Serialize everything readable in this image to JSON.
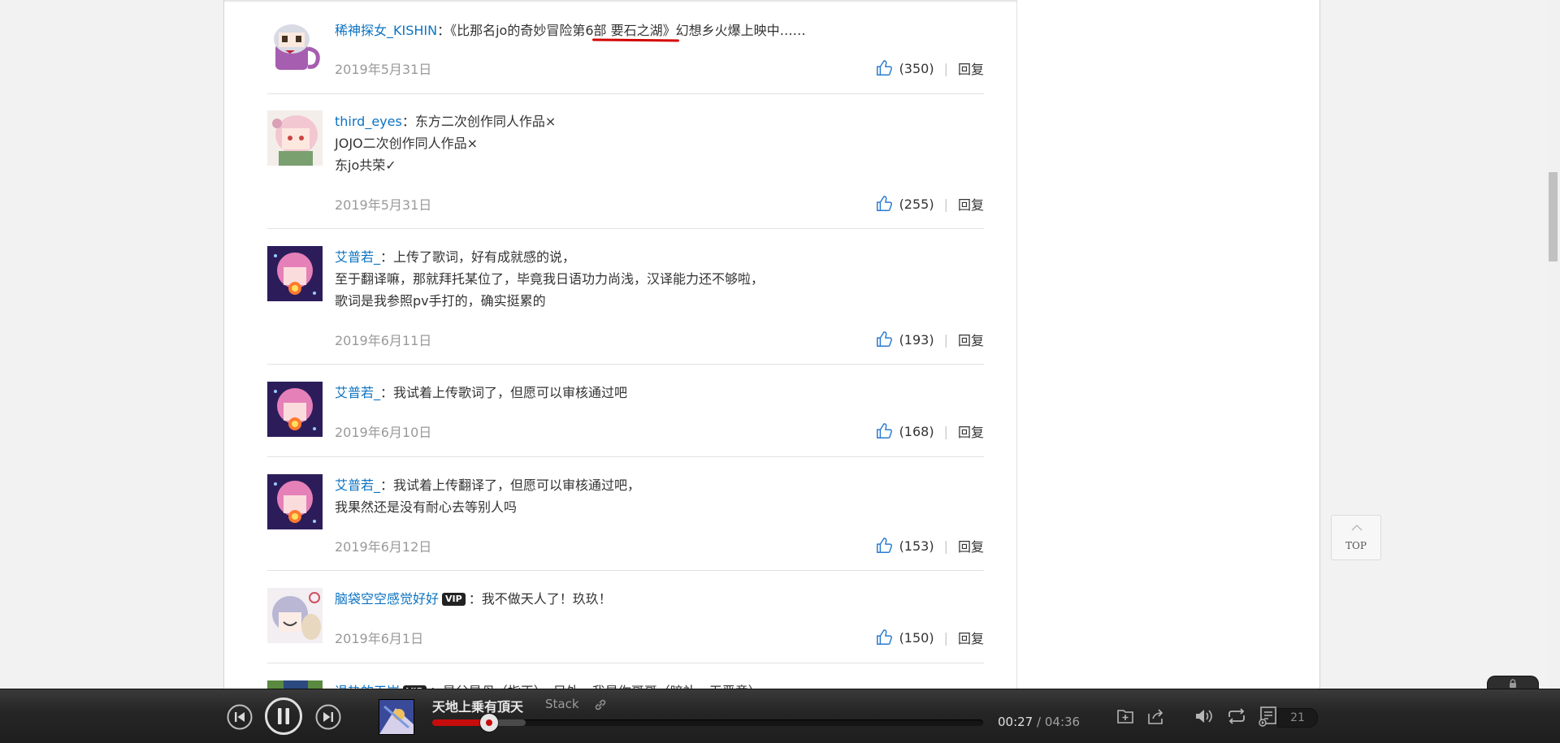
{
  "comments": [
    {
      "user": "稀神探女_KISHIN",
      "vip": "",
      "lines": [
        [
          "：《比那名jo的奇妙冒险第6",
          "部 要石之湖》",
          "幻想乡火爆上映中……"
        ]
      ],
      "date": "2019年5月31日",
      "likes": "(350)",
      "reply": "回复"
    },
    {
      "user": "third_eyes",
      "vip": "",
      "lines": [
        "：东方二次创作同人作品×",
        "JOJO二次创作同人作品×",
        "东jo共荣✓"
      ],
      "date": "2019年5月31日",
      "likes": "(255)",
      "reply": "回复"
    },
    {
      "user": "艾普若_",
      "vip": "",
      "lines": [
        "：上传了歌词，好有成就感的说，",
        "至于翻译嘛，那就拜托某位了，毕竟我日语功力尚浅，汉译能力还不够啦，",
        "歌词是我参照pv手打的，确实挺累的"
      ],
      "date": "2019年6月11日",
      "likes": "(193)",
      "reply": "回复"
    },
    {
      "user": "艾普若_",
      "vip": "",
      "lines": [
        "：我试着上传歌词了，但愿可以审核通过吧"
      ],
      "date": "2019年6月10日",
      "likes": "(168)",
      "reply": "回复"
    },
    {
      "user": "艾普若_",
      "vip": "",
      "lines": [
        "：我试着上传翻译了，但愿可以审核通过吧，",
        "我果然还是没有耐心去等别人吗"
      ],
      "date": "2019年6月12日",
      "likes": "(153)",
      "reply": "回复"
    },
    {
      "user": "脑袋空空感觉好好",
      "vip": "VIP",
      "lines": [
        "：我不做天人了！玖玖！"
      ],
      "date": "2019年6月1日",
      "likes": "(150)",
      "reply": "回复"
    },
    {
      "user": "退热的天崩",
      "vip": "VIP",
      "lines": [
        "：是父是母（指正），另外，我是你哥哥（暗补，无恶意）"
      ],
      "date": "",
      "likes": "",
      "reply": ""
    }
  ],
  "top_button": {
    "label": "TOP"
  },
  "player": {
    "song_title": "天地上乗有頂天",
    "artist": "Stack",
    "current_time": "00:27",
    "separator": "/",
    "total_time": "04:36",
    "progress": 0.103,
    "buffered": 0.17,
    "playlist_count": "21",
    "accent_color": "#c70c0c"
  },
  "colors": {
    "link_blue": "#0c73c2",
    "player_bg": "#262626"
  }
}
